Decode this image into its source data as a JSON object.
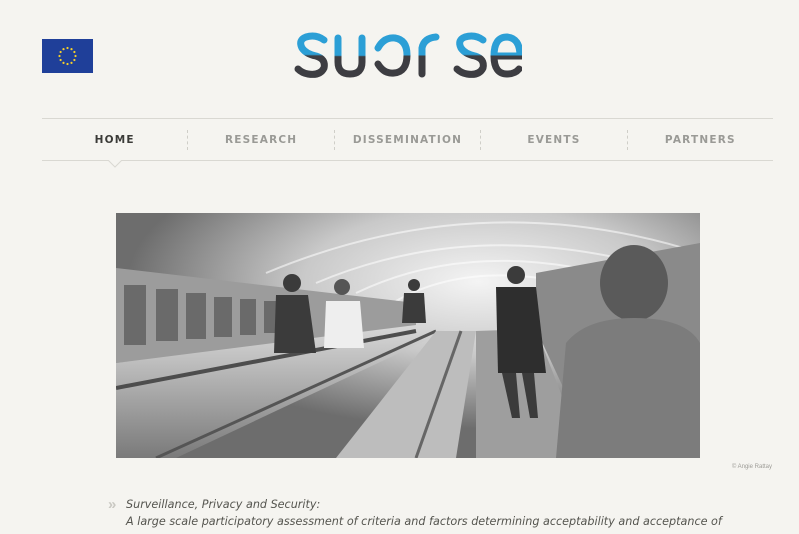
{
  "logo": {
    "text": "surprise",
    "alt": "surprise logo"
  },
  "eu_flag": {
    "name": "eu-flag"
  },
  "nav": {
    "items": [
      {
        "label": "HOME",
        "active": true
      },
      {
        "label": "RESEARCH",
        "active": false
      },
      {
        "label": "DISSEMINATION",
        "active": false
      },
      {
        "label": "EVENTS",
        "active": false
      },
      {
        "label": "PARTNERS",
        "active": false
      }
    ]
  },
  "hero": {
    "credit": "© Angie Rattay"
  },
  "intro": {
    "quote_icon": "double-chevron-right-icon",
    "line1": "Surveillance, Privacy and Security:",
    "line2": "A large scale participatory assessment of criteria and factors determining acceptability and acceptance of"
  },
  "colors": {
    "background": "#f5f4f0",
    "logo_dark": "#3d3d42",
    "logo_blue": "#2c9fd6",
    "nav_active": "#3b3b38",
    "nav_inactive": "#9a9a96"
  }
}
